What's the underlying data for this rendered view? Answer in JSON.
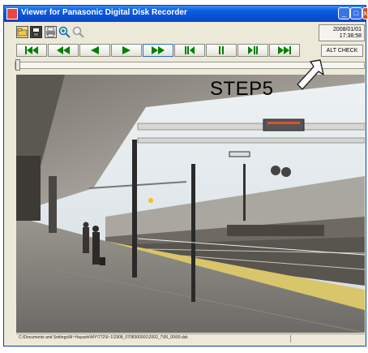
{
  "window": {
    "title": "Viewer for Panasonic Digital Disk Recorder",
    "min_glyph": "_",
    "max_glyph": "□",
    "close_glyph": "x"
  },
  "toolbar": {
    "icons": [
      "folder-open-icon",
      "save-icon",
      "print-icon",
      "zoom-in-icon",
      "zoom-out-icon"
    ],
    "date": "2008/01/01",
    "time": "17:38:58"
  },
  "playback": {
    "buttons": [
      "skip-to-start",
      "fast-rewind",
      "rewind",
      "play",
      "fast-forward",
      "frame-back",
      "pause",
      "frame-forward",
      "skip-to-end"
    ],
    "alt_check_label": "ALT CHECK"
  },
  "slider": {
    "position": 0
  },
  "status": {
    "path": "C:\\Documents and Settings\\M~Hayashi\\MY\\T72\\9~1\\2908_0708300901\\2002_7\\00_00\\00.dsk"
  },
  "annotation": {
    "label": "STEP5"
  },
  "colors": {
    "accent": "#008000",
    "title_bar": "#0a5fe0",
    "window_bg": "#ece9d8"
  }
}
